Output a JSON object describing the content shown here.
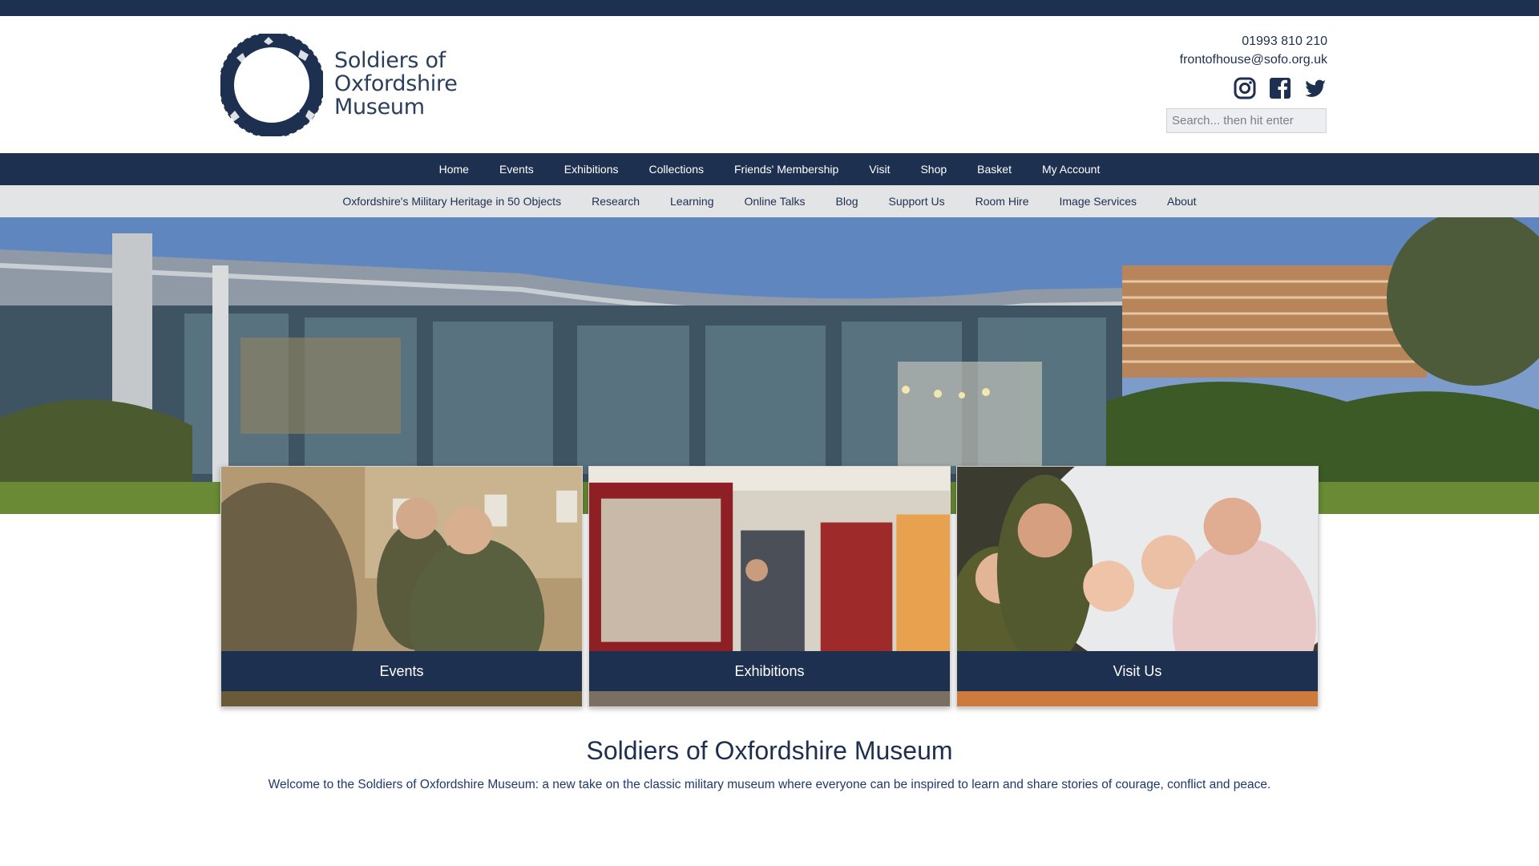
{
  "header": {
    "logo_lines": [
      "Soldiers of",
      "Oxfordshire",
      "Museum"
    ],
    "phone": "01993 810 210",
    "email": "frontofhouse@sofo.org.uk",
    "social_icons": [
      "instagram-icon",
      "facebook-icon",
      "twitter-icon"
    ],
    "search_placeholder": "Search... then hit enter"
  },
  "main_nav": {
    "items": [
      {
        "label": "Home"
      },
      {
        "label": "Events"
      },
      {
        "label": "Exhibitions"
      },
      {
        "label": "Collections"
      },
      {
        "label": "Friends' Membership"
      },
      {
        "label": "Visit"
      },
      {
        "label": "Shop"
      },
      {
        "label": "Basket"
      },
      {
        "label": "My Account"
      }
    ]
  },
  "sub_nav": {
    "items": [
      {
        "label": "Oxfordshire's Military Heritage in 50 Objects"
      },
      {
        "label": "Research"
      },
      {
        "label": "Learning"
      },
      {
        "label": "Online Talks"
      },
      {
        "label": "Blog"
      },
      {
        "label": "Support Us"
      },
      {
        "label": "Room Hire"
      },
      {
        "label": "Image Services"
      },
      {
        "label": "About"
      }
    ]
  },
  "cards": [
    {
      "label": "Events"
    },
    {
      "label": "Exhibitions"
    },
    {
      "label": "Visit Us"
    }
  ],
  "intro": {
    "title": "Soldiers of Oxfordshire Museum",
    "text": "Welcome to the Soldiers of Oxfordshire Museum: a new take on the classic military museum where everyone can be inspired to learn and share stories of courage, conflict and peace."
  },
  "colors": {
    "navy": "#1e3050",
    "subnav_bg": "#e3e4e6",
    "text": "#1e2f4f"
  }
}
